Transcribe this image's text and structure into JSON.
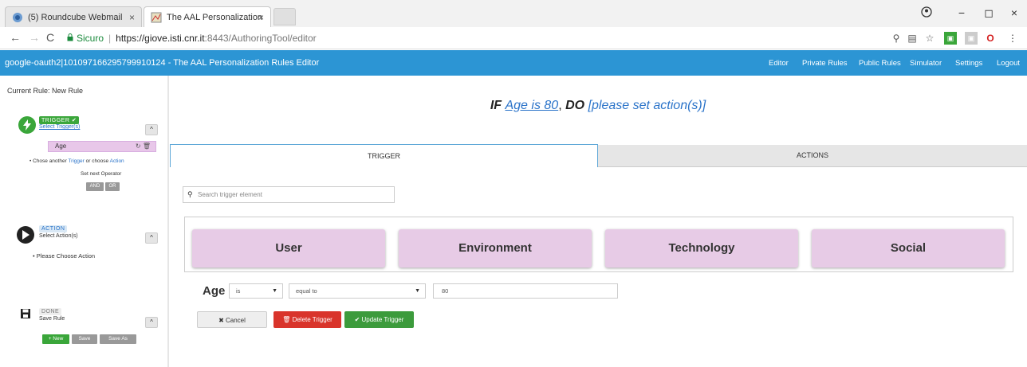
{
  "browser": {
    "tabs": [
      {
        "title": "(5) Roundcube Webmail",
        "close": "×"
      },
      {
        "title": "The AAL Personalization",
        "close": "×"
      }
    ],
    "secure_label": "Sicuro",
    "url_host": "https://giove.isti.cnr.it",
    "url_path": ":8443/AuthoringTool/editor",
    "window_controls": {
      "minimize": "−",
      "maximize": "◻",
      "close": "×"
    }
  },
  "header": {
    "title": "google-oauth2|101097166295799910124 - The AAL Personalization Rules Editor",
    "nav": [
      "Editor",
      "Private Rules",
      "Public Rules",
      "Simulator",
      "Settings",
      "Logout"
    ]
  },
  "sidebar": {
    "current_rule": "Current Rule: New Rule",
    "trigger": {
      "badge": "TRIGGER ✔",
      "link": "Select Trigger(s)",
      "chip": "Age",
      "hint_prefix": "Chose another",
      "hint_trigger": "Trigger",
      "hint_mid": "or choose",
      "hint_action": "Action",
      "operator_label": "Set next Operator",
      "op_and": "AND",
      "op_or": "OR"
    },
    "action": {
      "badge": "ACTION",
      "sub": "Select Action(s)",
      "hint": "Please Choose Action"
    },
    "done": {
      "badge": "DONE",
      "sub": "Save Rule",
      "new": "+ New",
      "save": "Save",
      "save_as": "Save As"
    }
  },
  "main": {
    "rule": {
      "if": "IF",
      "condition": "Age is 80",
      "comma": ",",
      "do": "DO",
      "action": "[please set action(s)]"
    },
    "tabs": {
      "trigger": "TRIGGER",
      "actions": "ACTIONS"
    },
    "search_placeholder": "Search trigger element",
    "categories": [
      "User",
      "Environment",
      "Technology",
      "Social"
    ],
    "condition": {
      "label": "Age",
      "operator": "is",
      "comparison": "equal to",
      "value": "80"
    },
    "buttons": {
      "cancel": "✖ Cancel",
      "delete": "🗑 Delete Trigger",
      "update": "✔ Update Trigger"
    }
  },
  "colors": {
    "header_bg": "#2c95d4",
    "category_bg": "#e7cbe6",
    "trigger_green": "#3aa63a",
    "delete_red": "#d9342b",
    "update_green": "#3c9b3c"
  }
}
